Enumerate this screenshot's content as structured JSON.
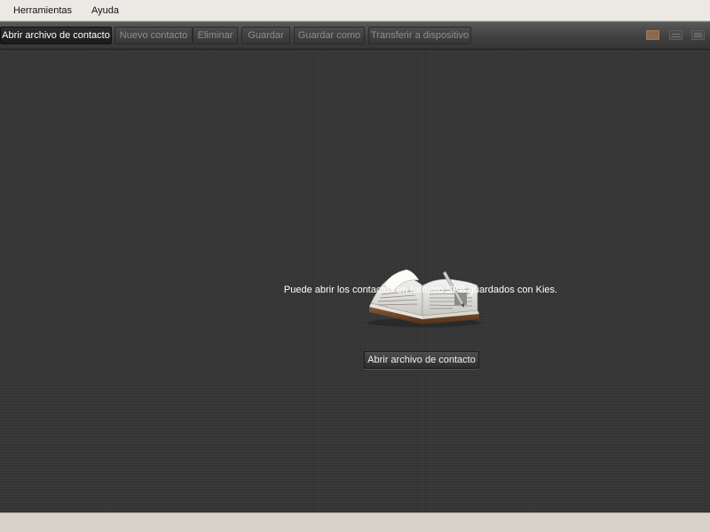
{
  "menubar": {
    "items": [
      "Herramientas",
      "Ayuda"
    ]
  },
  "toolbar": {
    "buttons": [
      {
        "label": "Abrir archivo de contacto",
        "active": true
      },
      {
        "label": "Nuevo contacto",
        "active": false
      },
      {
        "label": "Eliminar",
        "active": false
      },
      {
        "label": "Guardar",
        "active": false
      },
      {
        "label": "Guardar como",
        "active": false
      },
      {
        "label": "Transferir a dispositivo",
        "active": false
      }
    ],
    "view_icons": [
      "card-view-icon",
      "list-view-icon",
      "detail-view-icon"
    ]
  },
  "main": {
    "icon": "open-book-icon",
    "message": "Puede abrir los contactos en formato SPB guardados con Kies.",
    "open_button_label": "Abrir archivo de contacto"
  },
  "colors": {
    "background": "#3a3a3a",
    "menubar": "#ece9e4",
    "statusbar": "#d8d2c8",
    "active_view_icon": "#8a6a4e"
  }
}
